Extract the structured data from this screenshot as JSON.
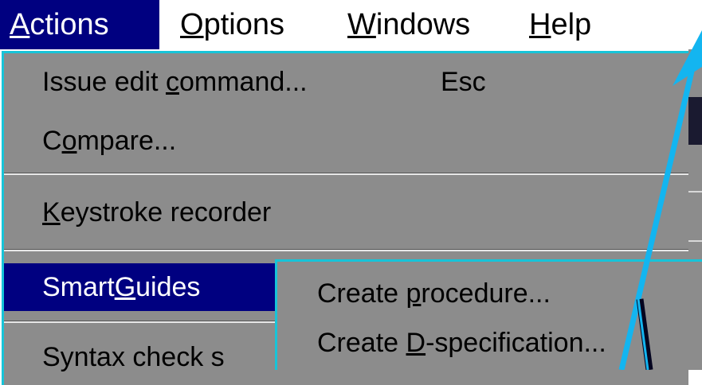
{
  "menubar": {
    "items": [
      {
        "pre": "",
        "u": "A",
        "post": "ctions",
        "active": true
      },
      {
        "pre": "",
        "u": "O",
        "post": "ptions"
      },
      {
        "pre": "",
        "u": "W",
        "post": "indows"
      },
      {
        "pre": "",
        "u": "H",
        "post": "elp"
      }
    ]
  },
  "actions_menu": {
    "items": [
      {
        "pre": "Issue edit ",
        "u": "c",
        "post": "ommand...",
        "accel": "Esc"
      },
      {
        "pre": "C",
        "u": "o",
        "post": "mpare..."
      },
      {
        "pre": "",
        "u": "K",
        "post": "eystroke recorder",
        "has_submenu": true
      },
      {
        "pre": "Smart",
        "u": "G",
        "post": "uides",
        "selected": true
      },
      {
        "pre": "Syntax check ",
        "u": "",
        "post": "s"
      }
    ]
  },
  "submenu": {
    "items": [
      {
        "pre": "Create ",
        "u": "p",
        "post": "rocedure..."
      },
      {
        "pre": "Create ",
        "u": "D",
        "post": "-specification..."
      }
    ]
  },
  "colors": {
    "menu_bg": "#8c8c8c",
    "selection": "#000080",
    "border_accent": "#17c4d8",
    "annotation_arrow": "#13b5f0"
  }
}
